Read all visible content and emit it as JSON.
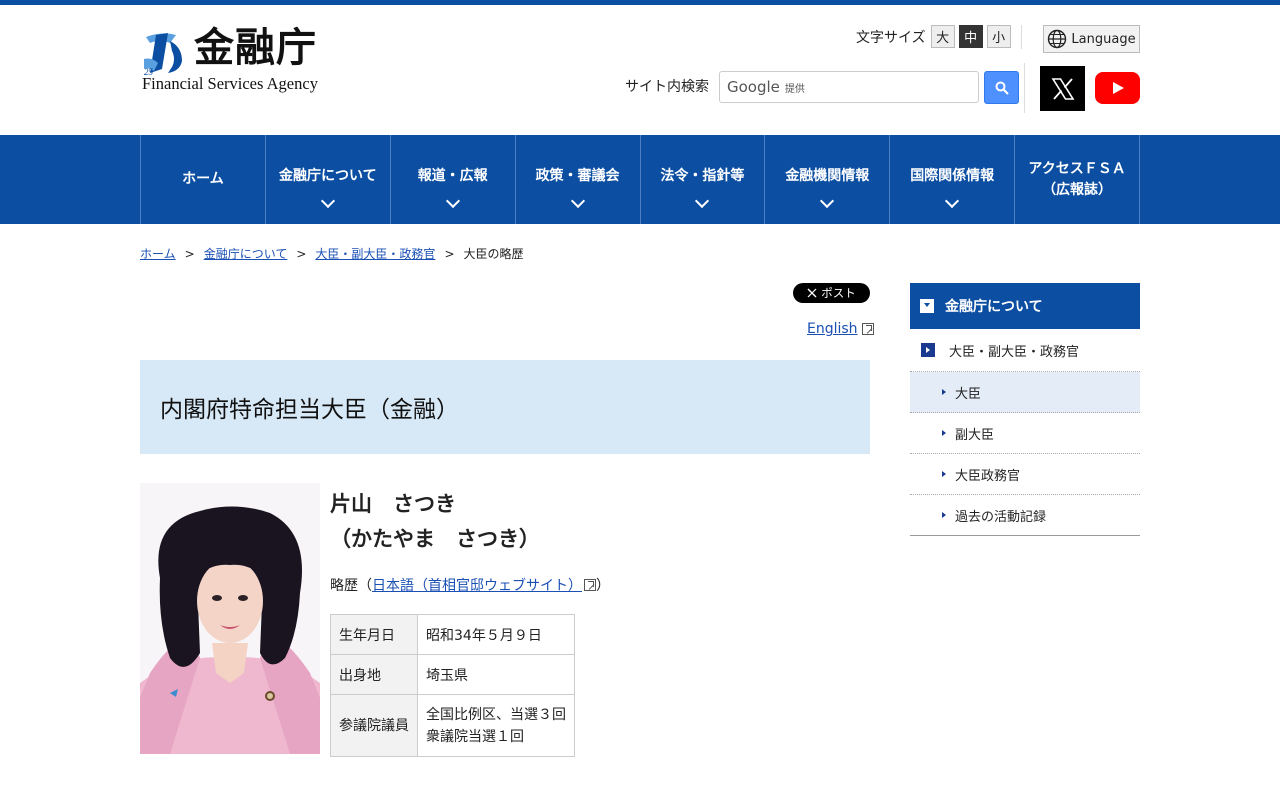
{
  "header": {
    "logo_jp": "金融庁",
    "logo_en": "Financial Services Agency",
    "font_size": {
      "label": "文字サイズ",
      "options": [
        "大",
        "中",
        "小"
      ],
      "active": "中"
    },
    "language_label": "Language",
    "search": {
      "label": "サイト内検索",
      "placeholder_brand": "Google",
      "placeholder_suffix": "提供"
    },
    "social": [
      "x-icon",
      "youtube-icon"
    ]
  },
  "nav": {
    "items": [
      {
        "label": "ホーム",
        "dropdown": false
      },
      {
        "label": "金融庁について",
        "dropdown": true
      },
      {
        "label": "報道・広報",
        "dropdown": true
      },
      {
        "label": "政策・審議会",
        "dropdown": true
      },
      {
        "label": "法令・指針等",
        "dropdown": true
      },
      {
        "label": "金融機関情報",
        "dropdown": true
      },
      {
        "label": "国際関係情報",
        "dropdown": true
      },
      {
        "label": "アクセスＦＳＡ\n（広報誌）",
        "dropdown": false
      }
    ]
  },
  "breadcrumb": {
    "items": [
      "ホーム",
      "金融庁について",
      "大臣・副大臣・政務官"
    ],
    "current": "大臣の略歴",
    "separator": ">"
  },
  "main": {
    "post_button": "ポスト",
    "english_link": "English",
    "title": "内閣府特命担当大臣（金融）",
    "name": "片山　さつき",
    "name_kana": "（かたやま　さつき）",
    "bio_prefix": "略歴（",
    "bio_link": "日本語（首相官邸ウェブサイト）",
    "bio_suffix": "）",
    "profile": [
      {
        "label": "生年月日",
        "value": "昭和34年５月９日"
      },
      {
        "label": "出身地",
        "value": "埼玉県"
      },
      {
        "label": "参議院議員",
        "value": "全国比例区、当選３回\n衆議院当選１回"
      }
    ]
  },
  "sidebar": {
    "heading": "金融庁について",
    "section": "大臣・副大臣・政務官",
    "items": [
      "大臣",
      "副大臣",
      "大臣政務官",
      "過去の活動記録"
    ],
    "active": "大臣"
  },
  "colors": {
    "brand_blue": "#0b4ea2",
    "title_bg": "#d7e8f6",
    "link": "#1a4fb4"
  }
}
